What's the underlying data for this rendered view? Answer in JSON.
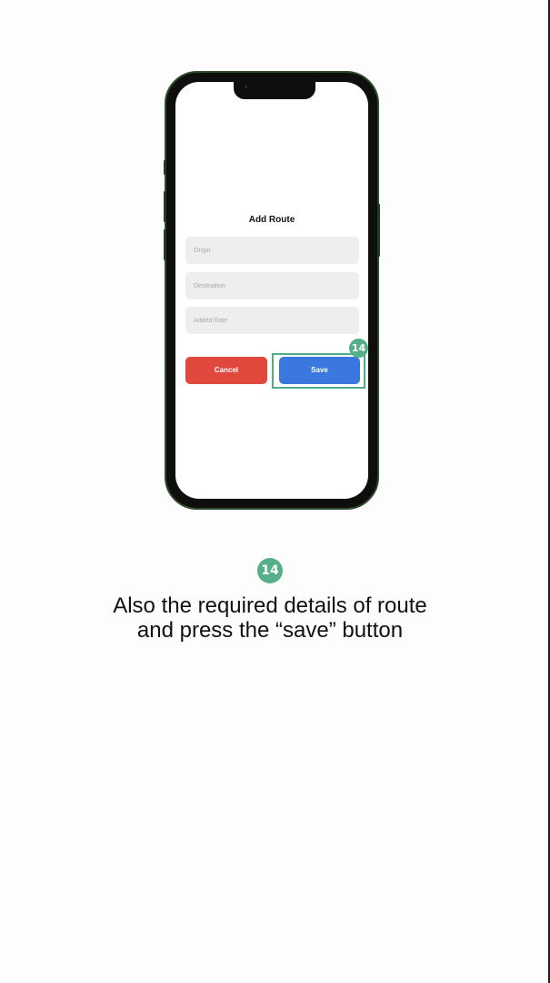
{
  "screen": {
    "title": "Add Route",
    "fields": {
      "origin": {
        "value": "",
        "placeholder": "Origin"
      },
      "destination": {
        "value": "",
        "placeholder": "Destination"
      },
      "added_rate": {
        "value": "",
        "placeholder": "Added Rate"
      }
    },
    "buttons": {
      "cancel_label": "Cancel",
      "save_label": "Save"
    }
  },
  "annotation": {
    "step_number": "14",
    "caption": "Also the required details of route and press the “save” button"
  },
  "colors": {
    "cancel_button": "#e0483d",
    "save_button": "#3a78e0",
    "highlight_accent": "#4fae85",
    "field_background": "#eeeeee"
  }
}
